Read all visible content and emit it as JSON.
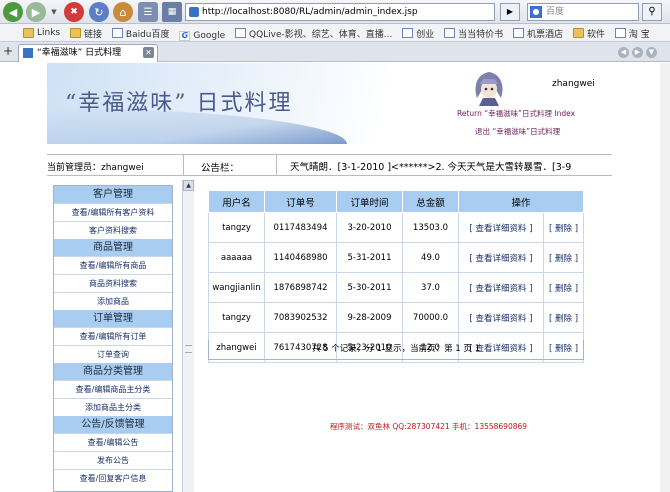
{
  "browser": {
    "address_url": "http://localhost:8080/RL/admin/admin_index.jsp",
    "search_placeholder": "百度",
    "bookmarks": [
      "Links",
      "链接",
      "Baidu百度",
      "Google",
      "QQLive-影视、综艺、体育、直播...",
      "创业",
      "当当特价书",
      "机票酒店",
      "软件",
      "淘 宝"
    ],
    "tab_title": "“幸福滋味” 日式料理"
  },
  "header": {
    "site_title": "“幸福滋味” 日式料理",
    "username": "zhangwei",
    "return_link": "Return “幸福滋味”日式料理 Index",
    "logout_link": "退出 “幸福滋味”日式料理"
  },
  "info": {
    "admin_label": "当前管理员：zhangwei",
    "notice_label": "公告栏：",
    "notice_text": "天气晴朗．[3-1-2010 ]<******>2. 今天天气是大雪转暴雪．[3-9"
  },
  "sidebar": {
    "sections": [
      {
        "title": "客户管理",
        "links": [
          "查看/编辑所有客户资料",
          "客户资料搜索"
        ]
      },
      {
        "title": "商品管理",
        "links": [
          "查看/编辑所有商品",
          "商品资料搜索",
          "添加商品"
        ]
      },
      {
        "title": "订单管理",
        "links": [
          "查看/编辑所有订单",
          "订单查询"
        ]
      },
      {
        "title": "商品分类管理",
        "links": [
          "查看/编辑商品主分类",
          "添加商品主分类"
        ]
      },
      {
        "title": "公告/反馈管理",
        "links": [
          "查看/编辑公告",
          "发布公告",
          "查看/回复客户信息"
        ]
      }
    ]
  },
  "orders": {
    "headers": [
      "用户名",
      "订单号",
      "订单时间",
      "总金额",
      "操作"
    ],
    "rows": [
      [
        "tangzy",
        "0117483494",
        "3-20-2010",
        "13503.0"
      ],
      [
        "aaaaaa",
        "1140468980",
        "5-31-2011",
        "49.0"
      ],
      [
        "wangjianlin",
        "1876898742",
        "5-30-2011",
        "37.0"
      ],
      [
        "tangzy",
        "7083902532",
        "9-28-2009",
        "70000.0"
      ],
      [
        "zhangwei",
        "7617430728",
        "5-23-2010",
        "12.0"
      ]
    ],
    "view_label": "[ 查看详细资料 ]",
    "delete_label": "[ 删除 ]",
    "pager_text": "共 5 个记录，分 1 显示，当前页：第 1 页   1"
  },
  "footer": {
    "text": "程序测试：双鱼林 QQ:287307421 手机：13558690869"
  },
  "colors": {
    "section_header_bg": "#a9cdf0",
    "link_color": "#1a2f6b",
    "footer_color": "#c01818"
  }
}
